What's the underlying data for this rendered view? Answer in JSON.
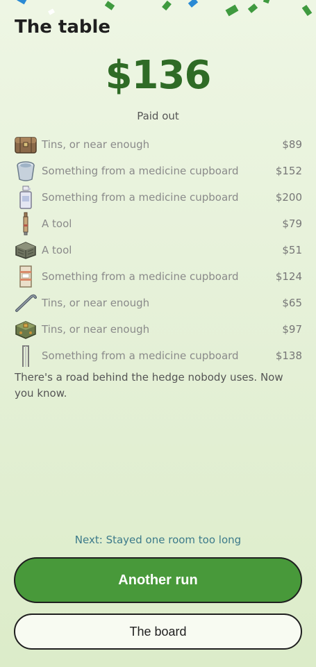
{
  "page": {
    "title": "The table",
    "amount": "$136",
    "paid_label": "Paid out",
    "blurb": "There's a road behind the hedge nobody uses. Now you know.",
    "next_label": "Next: Stayed one room too long"
  },
  "items": [
    {
      "icon": "chest-icon",
      "label": "Tins, or near enough",
      "price": "$89"
    },
    {
      "icon": "bucket-icon",
      "label": "Something from a medicine cupboard",
      "price": "$152"
    },
    {
      "icon": "bottle-icon",
      "label": "Something from a medicine cupboard",
      "price": "$200"
    },
    {
      "icon": "tool-stick-icon",
      "label": "A tool",
      "price": "$79"
    },
    {
      "icon": "crate-icon",
      "label": "A tool",
      "price": "$51"
    },
    {
      "icon": "box-icon",
      "label": "Something from a medicine cupboard",
      "price": "$124"
    },
    {
      "icon": "crowbar-icon",
      "label": "Tins, or near enough",
      "price": "$65"
    },
    {
      "icon": "ornate-chest-icon",
      "label": "Tins, or near enough",
      "price": "$97"
    },
    {
      "icon": "pipe-icon",
      "label": "Something from a medicine cupboard",
      "price": "$138"
    }
  ],
  "buttons": {
    "primary_label": "Another run",
    "secondary_label": "The board"
  },
  "colors": {
    "accent": "#48993a",
    "amount": "#2f6b26",
    "next_link": "#3c7a8a"
  }
}
